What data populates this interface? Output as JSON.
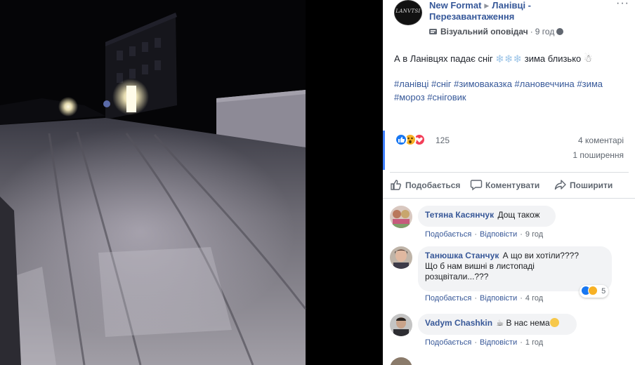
{
  "post": {
    "page_name": "New Format",
    "group_name": "Ланівці - Перезавантаження",
    "page_avatar_text": "LANVTSI",
    "badge": "Візуальний оповідач",
    "time": "9 год",
    "text": "А в Ланівцях падає сніг ❄️❄️❄️ зима близько ☃️",
    "text_before": "А в Ланівцях падає сніг",
    "snowflakes": "❄❄❄",
    "text_after": "зима близько",
    "snowman": "☃",
    "hashtags": "#ланівці #сніг #зимоваказка #лановеччина #зима #мороз #сніговик",
    "more_label": "···"
  },
  "stats": {
    "reaction_count": "125",
    "comments": "4 коментарі",
    "shares": "1 поширення"
  },
  "actions": {
    "like": "Подобається",
    "comment": "Коментувати",
    "share": "Поширити"
  },
  "comments": [
    {
      "author": "Тетяна Касянчук",
      "text": "Дощ також",
      "like": "Подобається",
      "reply": "Відповісти",
      "time": "9 год"
    },
    {
      "author": "Танюшка Станчук",
      "text": "А що ви хотіли???? Що б нам вишні в листопаді розцвітали...???",
      "text_line1": "А що ви хотіли????",
      "text_line2": "Що б нам вишні в листопаді",
      "text_line3": "розцвітали...???",
      "like": "Подобається",
      "reply": "Відповісти",
      "time": "4 год",
      "reaction_count": "5"
    },
    {
      "author": "Vadym Chashkin",
      "text": "☕ В нас нема😌",
      "text_main": "В нас нема",
      "like": "Подобається",
      "reply": "Відповісти",
      "time": "1 год"
    }
  ],
  "colors": {
    "link": "#365899",
    "accent": "#4080ff",
    "like_blue": "#1877f2",
    "love_red": "#f33e58",
    "wow_yellow": "#f7b125"
  },
  "icons": [
    "more-icon",
    "visual-storyteller-icon",
    "globe-icon",
    "like-reaction-icon",
    "wow-reaction-icon",
    "love-reaction-icon",
    "like-icon",
    "comment-icon",
    "share-icon",
    "coffee-icon",
    "relieved-face-icon",
    "laughing-face-icon"
  ]
}
